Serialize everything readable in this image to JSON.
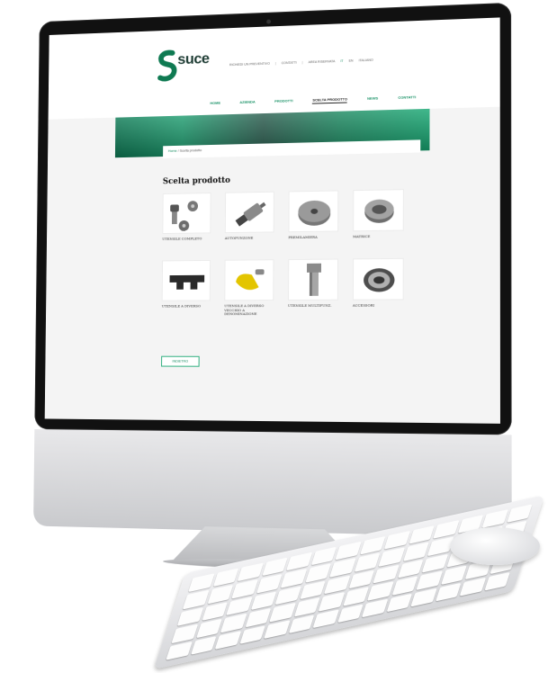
{
  "brand": {
    "name": "suce",
    "color": "#159064"
  },
  "top_links": [
    "RICHIEDI UN PREVENTIVO",
    "CONTATTI",
    "AREA RISERVATA",
    "IT",
    "EN",
    "ITALIANO"
  ],
  "nav": [
    {
      "label": "Home"
    },
    {
      "label": "Azienda"
    },
    {
      "label": "Prodotti"
    },
    {
      "label": "Scelta prodotto",
      "active": true
    },
    {
      "label": "News"
    },
    {
      "label": "Contatti"
    }
  ],
  "breadcrumb": {
    "home": "Home",
    "current": "Scelta prodotto"
  },
  "page_title": "Scelta prodotto",
  "products": [
    {
      "label": "UTENSILE COMPLETO",
      "icon": "complete-tool-icon"
    },
    {
      "label": "AUTOPUNZONE",
      "icon": "self-punch-icon"
    },
    {
      "label": "PREMILAMIERA",
      "icon": "stripper-icon"
    },
    {
      "label": "MATRICE",
      "icon": "die-icon"
    },
    {
      "label": "UTENSILE A DIVERSO",
      "icon": "special-tool-icon"
    },
    {
      "label": "UTENSILE A DIVERSO VECCHIO A DENOMINAZIONE",
      "icon": "yellow-tool-icon"
    },
    {
      "label": "UTENSILE MULTIFUNZ.",
      "icon": "multitool-icon"
    },
    {
      "label": "ACCESSORI",
      "icon": "accessory-icon"
    }
  ],
  "back_button": "INDIETRO"
}
